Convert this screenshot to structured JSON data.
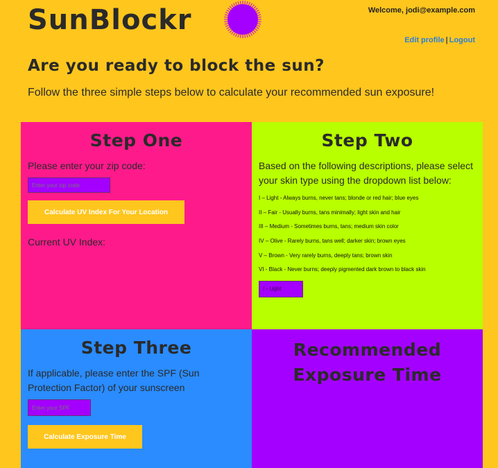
{
  "header": {
    "logo": "SunBlockr",
    "welcome": "Welcome, jodi@example.com",
    "edit_profile": "Edit profile",
    "separator": "|",
    "logout": "Logout"
  },
  "intro": {
    "headline": "Are you ready to block the sun?",
    "text": "Follow the three simple steps below to calculate your recommended sun exposure!"
  },
  "step_one": {
    "title": "Step One",
    "prompt": "Please enter your zip code:",
    "zip_placeholder": "Enter your zip code",
    "button": "Calculate UV Index For Your Location",
    "uv_label": "Current UV Index:"
  },
  "step_two": {
    "title": "Step Two",
    "prompt": "Based on the following descriptions, please select your skin type using the dropdown list below:",
    "skin_types": [
      "I – Light - Always burns, never tans; blonde or red hair; blue eyes",
      "II – Fair - Usually burns, tans minimally; light skin and hair",
      "III – Medium - Sometimes burns, tans; medium skin color",
      "IV – Olive - Rarely burns, tans well; darker skin; brown eyes",
      "V – Brown - Very rarely burns, deeply tans; brown skin",
      "VI - Black - Never burns; deeply pigmented dark brown to black skin"
    ],
    "select_value": "I - Light"
  },
  "step_three": {
    "title": "Step Three",
    "prompt": "If applicable, please enter the SPF (Sun Protection Factor) of your sunscreen",
    "spf_placeholder": "Enter your SPF",
    "button": "Calculate Exposure Time"
  },
  "result": {
    "title": "Recommended Exposure Time"
  },
  "colors": {
    "background": "#ffc61e",
    "step_one": "#ff1a8c",
    "step_two": "#b8ff00",
    "step_three": "#2a8cff",
    "result": "#a400ff",
    "link": "#2b7fd8"
  },
  "icons": {
    "logo_sun": "sun-icon"
  }
}
